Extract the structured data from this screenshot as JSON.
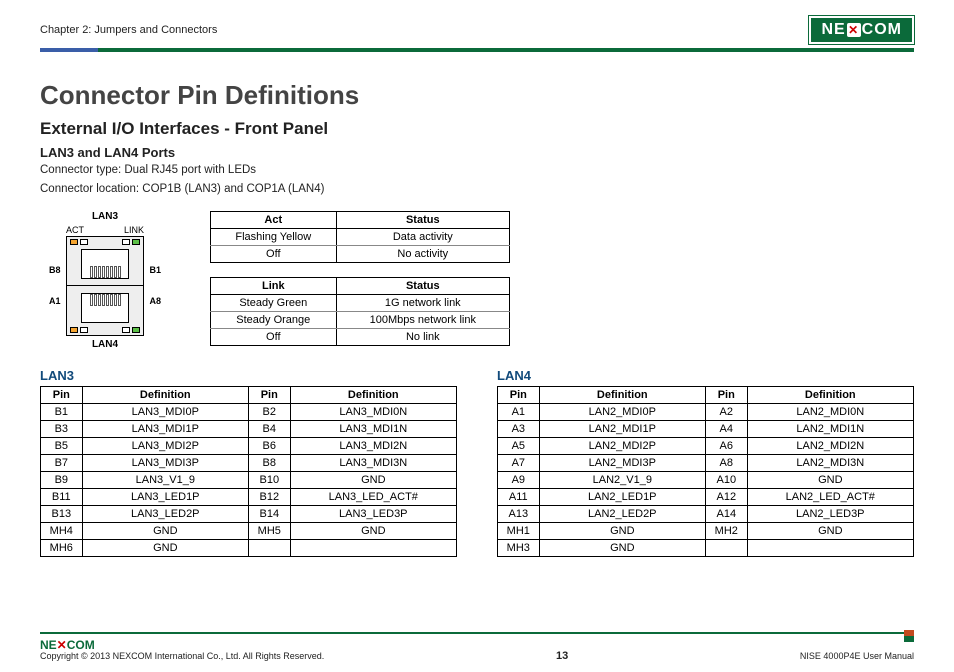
{
  "header": {
    "chapter": "Chapter 2: Jumpers and Connectors",
    "brand": "NEXCOM"
  },
  "titles": {
    "main": "Connector Pin Definitions",
    "sub1": "External I/O Interfaces - Front Panel",
    "sub2": "LAN3 and LAN4 Ports"
  },
  "desc": {
    "line1": "Connector type: Dual RJ45 port with LEDs",
    "line2": "Connector location: COP1B (LAN3) and COP1A (LAN4)"
  },
  "connector": {
    "top": "LAN3",
    "bottom": "LAN4",
    "act": "ACT",
    "link": "LINK",
    "b1": "B1",
    "b8": "B8",
    "a1": "A1",
    "a8": "A8"
  },
  "act_table": {
    "h1": "Act",
    "h2": "Status",
    "rows": [
      {
        "a": "Flashing Yellow",
        "b": "Data activity"
      },
      {
        "a": "Off",
        "b": "No activity"
      }
    ]
  },
  "link_table": {
    "h1": "Link",
    "h2": "Status",
    "rows": [
      {
        "a": "Steady Green",
        "b": "1G network link"
      },
      {
        "a": "Steady Orange",
        "b": "100Mbps network link"
      },
      {
        "a": "Off",
        "b": "No link"
      }
    ]
  },
  "lan3": {
    "title": "LAN3",
    "h_pin": "Pin",
    "h_def": "Definition",
    "rows": [
      {
        "p1": "B1",
        "d1": "LAN3_MDI0P",
        "p2": "B2",
        "d2": "LAN3_MDI0N"
      },
      {
        "p1": "B3",
        "d1": "LAN3_MDI1P",
        "p2": "B4",
        "d2": "LAN3_MDI1N"
      },
      {
        "p1": "B5",
        "d1": "LAN3_MDI2P",
        "p2": "B6",
        "d2": "LAN3_MDI2N"
      },
      {
        "p1": "B7",
        "d1": "LAN3_MDI3P",
        "p2": "B8",
        "d2": "LAN3_MDI3N"
      },
      {
        "p1": "B9",
        "d1": "LAN3_V1_9",
        "p2": "B10",
        "d2": "GND"
      },
      {
        "p1": "B11",
        "d1": "LAN3_LED1P",
        "p2": "B12",
        "d2": "LAN3_LED_ACT#"
      },
      {
        "p1": "B13",
        "d1": "LAN3_LED2P",
        "p2": "B14",
        "d2": "LAN3_LED3P"
      },
      {
        "p1": "MH4",
        "d1": "GND",
        "p2": "MH5",
        "d2": "GND"
      },
      {
        "p1": "MH6",
        "d1": "GND",
        "p2": "",
        "d2": ""
      }
    ]
  },
  "lan4": {
    "title": "LAN4",
    "h_pin": "Pin",
    "h_def": "Definition",
    "rows": [
      {
        "p1": "A1",
        "d1": "LAN2_MDI0P",
        "p2": "A2",
        "d2": "LAN2_MDI0N"
      },
      {
        "p1": "A3",
        "d1": "LAN2_MDI1P",
        "p2": "A4",
        "d2": "LAN2_MDI1N"
      },
      {
        "p1": "A5",
        "d1": "LAN2_MDI2P",
        "p2": "A6",
        "d2": "LAN2_MDI2N"
      },
      {
        "p1": "A7",
        "d1": "LAN2_MDI3P",
        "p2": "A8",
        "d2": "LAN2_MDI3N"
      },
      {
        "p1": "A9",
        "d1": "LAN2_V1_9",
        "p2": "A10",
        "d2": "GND"
      },
      {
        "p1": "A11",
        "d1": "LAN2_LED1P",
        "p2": "A12",
        "d2": "LAN2_LED_ACT#"
      },
      {
        "p1": "A13",
        "d1": "LAN2_LED2P",
        "p2": "A14",
        "d2": "LAN2_LED3P"
      },
      {
        "p1": "MH1",
        "d1": "GND",
        "p2": "MH2",
        "d2": "GND"
      },
      {
        "p1": "MH3",
        "d1": "GND",
        "p2": "",
        "d2": ""
      }
    ]
  },
  "footer": {
    "copyright": "Copyright © 2013 NEXCOM International Co., Ltd. All Rights Reserved.",
    "page": "13",
    "doc": "NISE 4000P4E User Manual",
    "brand_sm": "NEXCOM"
  }
}
